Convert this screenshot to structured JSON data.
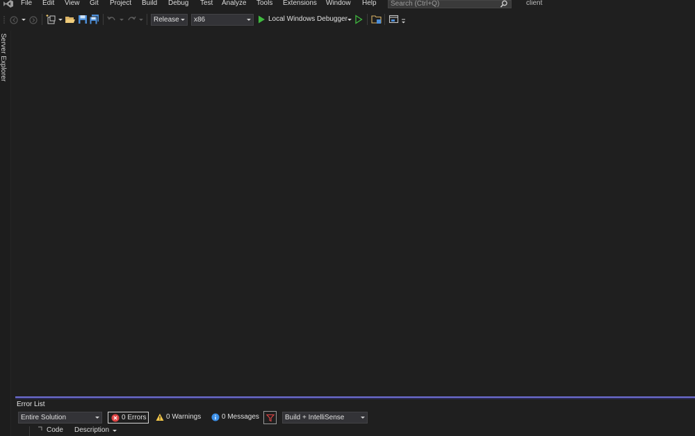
{
  "menu": {
    "items": [
      "File",
      "Edit",
      "View",
      "Git",
      "Project",
      "Build",
      "Debug",
      "Test",
      "Analyze",
      "Tools",
      "Extensions",
      "Window",
      "Help"
    ],
    "search_placeholder": "Search (Ctrl+Q)",
    "solution_name": "client"
  },
  "toolbar": {
    "configuration": "Release",
    "platform": "x86",
    "run_target": "Local Windows Debugger",
    "icons": [
      "back-icon",
      "forward-icon",
      "new-project-icon",
      "open-folder-icon",
      "save-icon",
      "save-all-icon",
      "undo-icon",
      "redo-icon",
      "start-debugging-icon",
      "start-without-debugging-icon",
      "browse-folder-icon",
      "device-window-icon"
    ]
  },
  "side_panel": {
    "label": "Server Explorer"
  },
  "error_list": {
    "title": "Error List",
    "scope": "Entire Solution",
    "errors_label": "0 Errors",
    "warnings_label": "0 Warnings",
    "messages_label": "0 Messages",
    "build_option": "Build + IntelliSense",
    "columns": [
      "Code",
      "Description"
    ]
  },
  "colors": {
    "background": "#1f1f1f",
    "accent": "#6f6fd6",
    "run_green": "#3fb93f"
  }
}
